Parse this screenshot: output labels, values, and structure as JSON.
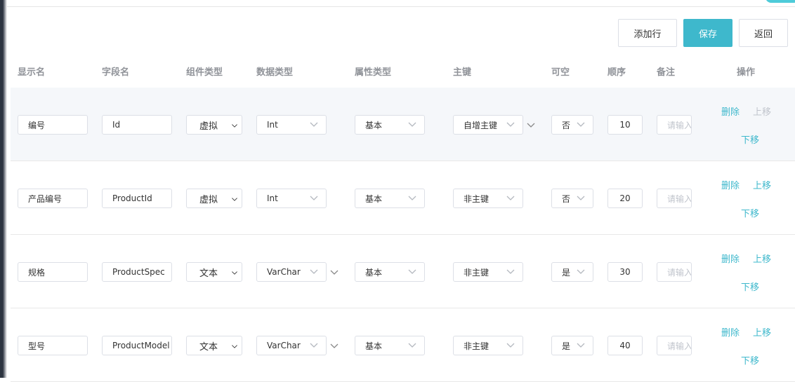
{
  "toolbar": {
    "add_row_label": "添加行",
    "save_label": "保存",
    "back_label": "返回"
  },
  "colors": {
    "accent": "#3eb8cc",
    "header_text": "#909399",
    "disabled": "#c0c4cc"
  },
  "table": {
    "headers": [
      "显示名",
      "字段名",
      "组件类型",
      "数据类型",
      "属性类型",
      "主键",
      "可空",
      "顺序",
      "备注",
      "操作"
    ],
    "remark_placeholder": "请输入",
    "actions": {
      "delete": "删除",
      "move_up": "上移",
      "move_down": "下移"
    },
    "rows": [
      {
        "display_name": "编号",
        "field_name": "Id",
        "component_type": "虚拟",
        "data_type": "Int",
        "attr_type": "基本",
        "primary_key": "自增主键",
        "nullable": "否",
        "order": "10",
        "remark": "",
        "move_up_disabled": true
      },
      {
        "display_name": "产品编号",
        "field_name": "ProductId",
        "component_type": "虚拟",
        "data_type": "Int",
        "attr_type": "基本",
        "primary_key": "非主键",
        "nullable": "否",
        "order": "20",
        "remark": "",
        "move_up_disabled": false
      },
      {
        "display_name": "规格",
        "field_name": "ProductSpec",
        "component_type": "文本",
        "data_type": "VarChar",
        "attr_type": "基本",
        "primary_key": "非主键",
        "nullable": "是",
        "order": "30",
        "remark": "",
        "move_up_disabled": false
      },
      {
        "display_name": "型号",
        "field_name": "ProductModel",
        "component_type": "文本",
        "data_type": "VarChar",
        "attr_type": "基本",
        "primary_key": "非主键",
        "nullable": "是",
        "order": "40",
        "remark": "",
        "move_up_disabled": false
      }
    ]
  }
}
